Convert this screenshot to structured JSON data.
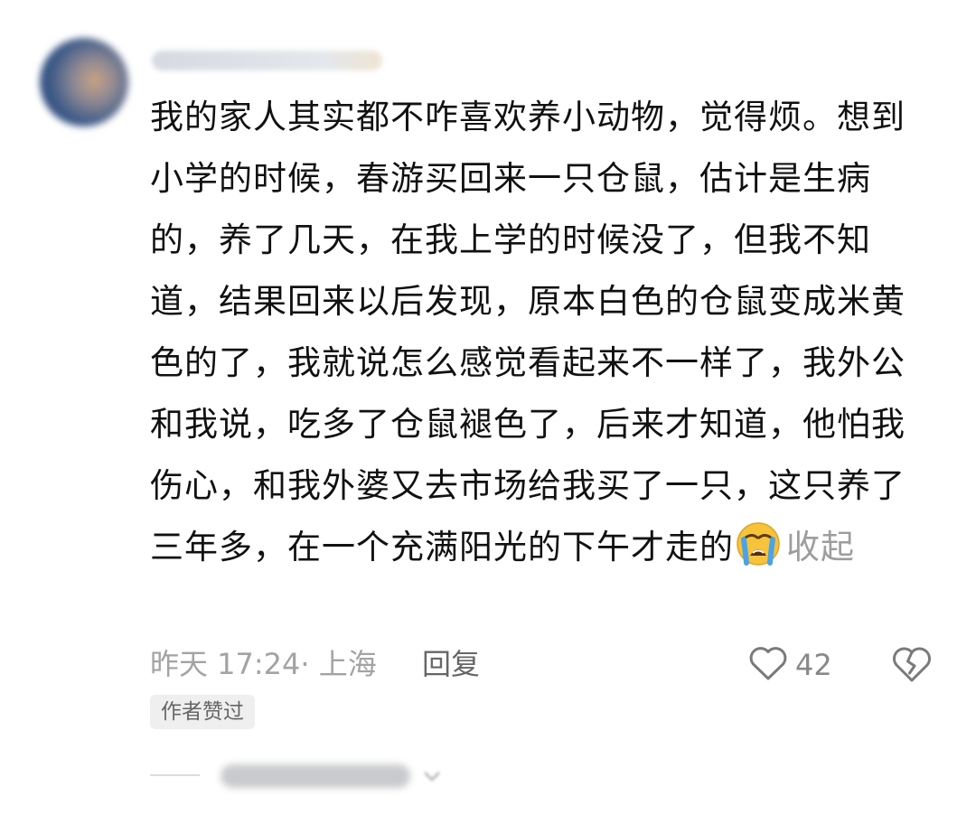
{
  "comment": {
    "text": "我的家人其实都不咋喜欢养小动物，觉得烦。想到小学的时候，春游买回来一只仓鼠，估计是生病的，养了几天，在我上学的时候没了，但我不知道，结果回来以后发现，原本白色的仓鼠变成米黄色的了，我就说怎么感觉看起来不一样了，我外公和我说，吃多了仓鼠褪色了，后来才知道，他怕我伤心，和我外婆又去市场给我买了一只，这只养了三年多，在一个充满阳光的下午才走的",
    "emoji_icon": "loudly-crying-face-icon",
    "collapse_label": "收起"
  },
  "meta": {
    "time_location": "昨天 17:24· 上海",
    "reply_label": "回复"
  },
  "actions": {
    "like_icon": "heart-outline-icon",
    "like_count": "42",
    "dislike_icon": "broken-heart-outline-icon"
  },
  "badge": {
    "author_liked": "作者赞过"
  },
  "colors": {
    "text": "#111111",
    "muted": "#a3a3a3",
    "badge_bg": "#efefef"
  }
}
